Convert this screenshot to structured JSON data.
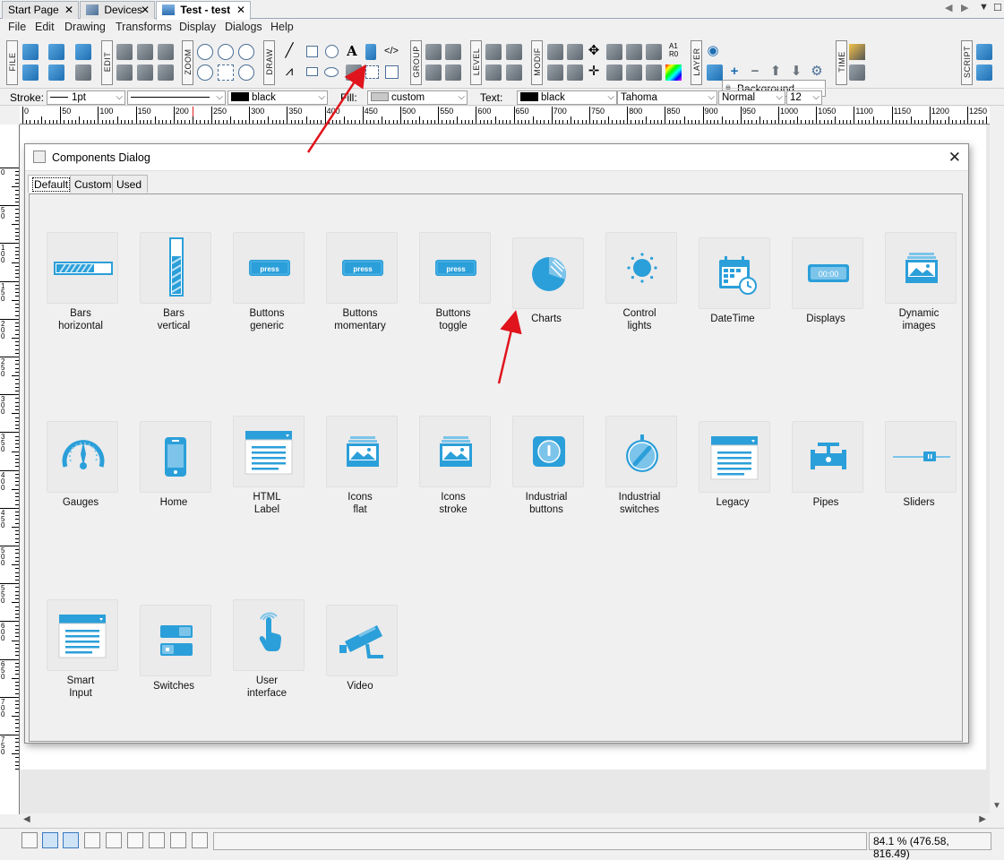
{
  "doc_tabs": [
    {
      "label": "Start Page",
      "close": "✕"
    },
    {
      "label": "Devices",
      "close": "✕"
    },
    {
      "label": "Test - test",
      "close": "✕"
    }
  ],
  "menu": [
    "File",
    "Edit",
    "Drawing",
    "Transforms",
    "Display",
    "Dialogs",
    "Help"
  ],
  "toolbar": {
    "groups": [
      "FILE",
      "EDIT",
      "ZOOM",
      "DRAW",
      "GROUP",
      "LEVEL",
      "MODIF",
      "LAYER",
      "TIME",
      "SCRIPT"
    ],
    "layer_name": "Background",
    "a1_label": "A1",
    "r0_label": "R0"
  },
  "props": {
    "stroke_label": "Stroke:",
    "stroke_width": "1pt",
    "stroke_color": "black",
    "fill_label": "Fill:",
    "fill_value": "custom",
    "text_label": "Text:",
    "text_color": "black",
    "font": "Tahoma",
    "style": "Normal",
    "size": "12"
  },
  "ruler_ticks": [
    "0",
    "50",
    "100",
    "150",
    "200",
    "250",
    "300",
    "350",
    "400",
    "450",
    "500",
    "550",
    "600",
    "650",
    "700",
    "750",
    "800",
    "850",
    "900",
    "950",
    "1000",
    "1050",
    "1100",
    "1150",
    "1200",
    "1250"
  ],
  "vruler_ticks": [
    "0",
    "50",
    "100",
    "150",
    "200",
    "250",
    "300",
    "350",
    "400",
    "450",
    "500",
    "550",
    "600",
    "650",
    "700",
    "750"
  ],
  "dialog": {
    "title": "Components Dialog",
    "close": "✕",
    "tabs": [
      "Default",
      "Custom",
      "Used"
    ],
    "components": [
      {
        "label": "Bars\nhorizontal",
        "icon": "bars-horizontal-icon"
      },
      {
        "label": "Bars\nvertical",
        "icon": "bars-vertical-icon"
      },
      {
        "label": "Buttons\ngeneric",
        "icon": "button-generic-icon",
        "text": "press"
      },
      {
        "label": "Buttons\nmomentary",
        "icon": "button-momentary-icon",
        "text": "press"
      },
      {
        "label": "Buttons\ntoggle",
        "icon": "button-toggle-icon",
        "text": "press"
      },
      {
        "label": "Charts",
        "icon": "pie-chart-icon"
      },
      {
        "label": "Control\nlights",
        "icon": "control-light-icon"
      },
      {
        "label": "DateTime",
        "icon": "calendar-clock-icon"
      },
      {
        "label": "Displays",
        "icon": "display-icon",
        "text": "00:00"
      },
      {
        "label": "Dynamic\nimages",
        "icon": "dynamic-images-icon"
      },
      {
        "label": "Gauges",
        "icon": "gauge-icon"
      },
      {
        "label": "Home",
        "icon": "phone-icon"
      },
      {
        "label": "HTML\nLabel",
        "icon": "html-label-icon"
      },
      {
        "label": "Icons\nflat",
        "icon": "icons-flat-icon"
      },
      {
        "label": "Icons\nstroke",
        "icon": "icons-stroke-icon"
      },
      {
        "label": "Industrial\nbuttons",
        "icon": "industrial-button-icon"
      },
      {
        "label": "Industrial\nswitches",
        "icon": "industrial-switch-icon"
      },
      {
        "label": "Legacy",
        "icon": "legacy-icon"
      },
      {
        "label": "Pipes",
        "icon": "pipes-icon"
      },
      {
        "label": "Sliders",
        "icon": "slider-icon"
      },
      {
        "label": "Smart\nInput",
        "icon": "smart-input-icon"
      },
      {
        "label": "Switches",
        "icon": "switches-icon"
      },
      {
        "label": "User\ninterface",
        "icon": "touch-hand-icon"
      },
      {
        "label": "Video",
        "icon": "camera-icon"
      }
    ]
  },
  "status": {
    "zoom_coords": "84.1 %  (476.58, 816.49)"
  },
  "colors": {
    "accent": "#2b9fd9",
    "accent_light": "#7cc4ea",
    "annotation_arrow": "#e0141c"
  }
}
